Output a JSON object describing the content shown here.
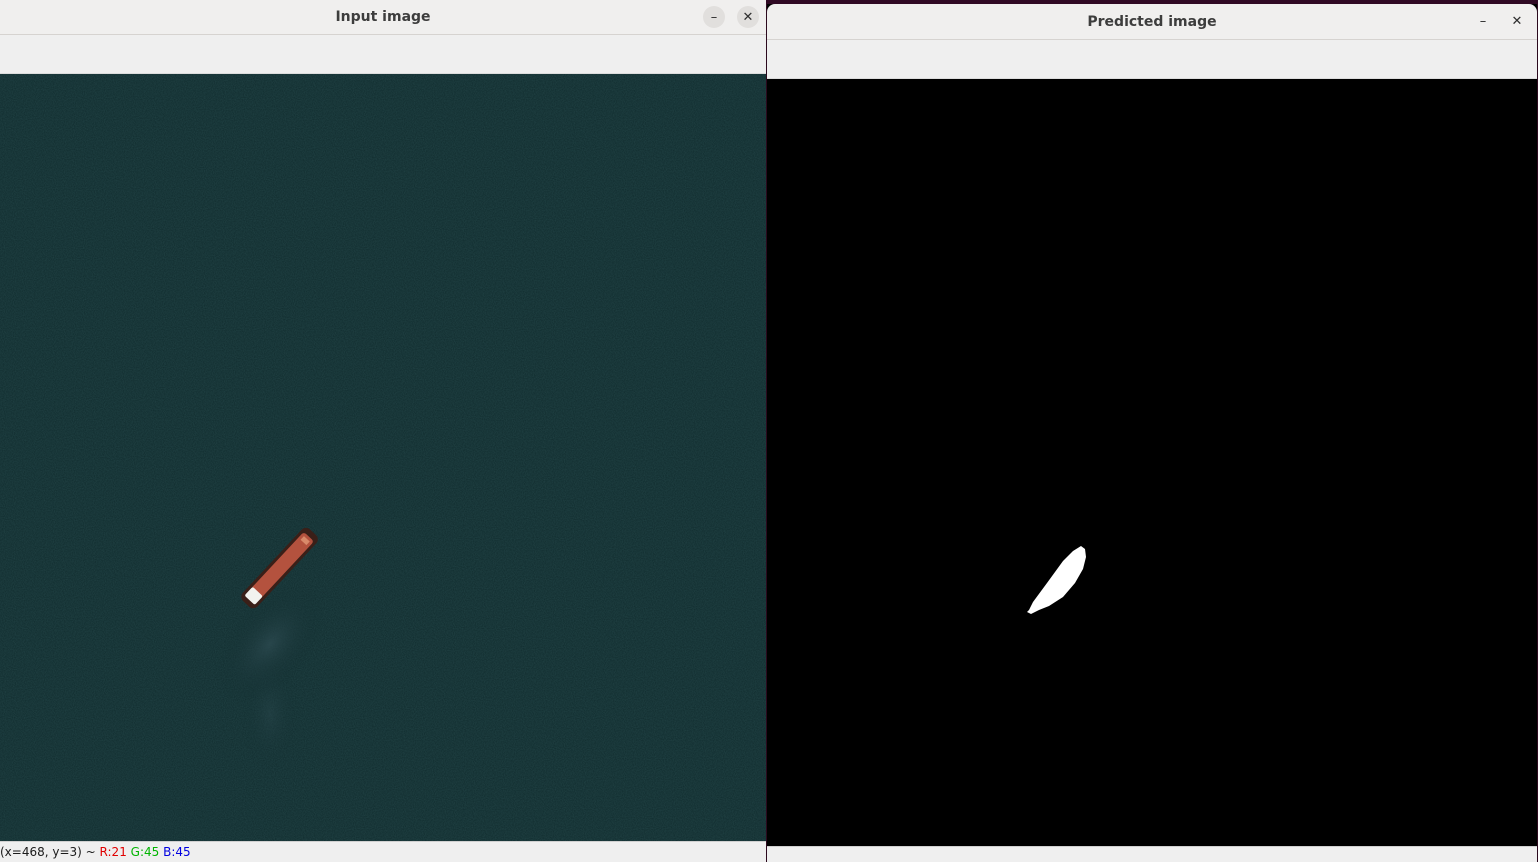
{
  "left_window": {
    "title": "Input image",
    "minimize_glyph": "–",
    "close_glyph": "✕",
    "status": {
      "coords": "(x=468, y=3) ~",
      "r": "R:21",
      "g": "G:45",
      "b": "B:45"
    }
  },
  "right_window": {
    "title": "Predicted image",
    "minimize_glyph": "–",
    "close_glyph": "✕"
  },
  "colors": {
    "sea": "#0f2a2c",
    "ship_hull": "#b4523e",
    "mask_background": "#000000",
    "mask_foreground": "#ffffff"
  }
}
